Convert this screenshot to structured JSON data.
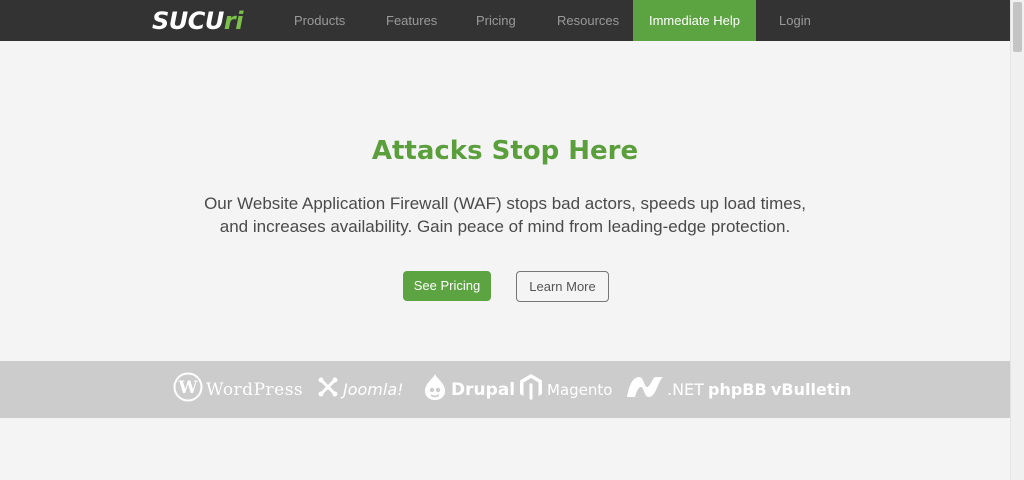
{
  "brand": {
    "logo_main": "SUCU",
    "logo_accent": "ri",
    "accent_color": "#5ca342",
    "nav_bg": "#333333"
  },
  "nav": {
    "items": [
      {
        "label": "Products"
      },
      {
        "label": "Features"
      },
      {
        "label": "Pricing"
      },
      {
        "label": "Resources"
      },
      {
        "label": "Immediate Help",
        "highlighted": true
      },
      {
        "label": "Login"
      }
    ]
  },
  "hero": {
    "title": "Attacks Stop Here",
    "description_line1": "Our Website Application Firewall (WAF) stops bad actors, speeds up load times,",
    "description_line2": "and increases availability. Gain peace of mind from leading-edge protection.",
    "primary_button": "See Pricing",
    "secondary_button": "Learn More"
  },
  "platforms": {
    "items": [
      {
        "label": "WordPress",
        "icon": "wordpress-logo"
      },
      {
        "label": "Joomla!",
        "icon": "joomla-logo"
      },
      {
        "label": "Drupal",
        "icon": "drupal-logo"
      },
      {
        "label": "Magento",
        "icon": "magento-logo"
      },
      {
        "label": ".NET",
        "icon": "dotnet-logo"
      },
      {
        "label": "phpBB",
        "icon": "phpbb-logo"
      },
      {
        "label": "vBulletin",
        "icon": "vbulletin-logo"
      }
    ]
  }
}
